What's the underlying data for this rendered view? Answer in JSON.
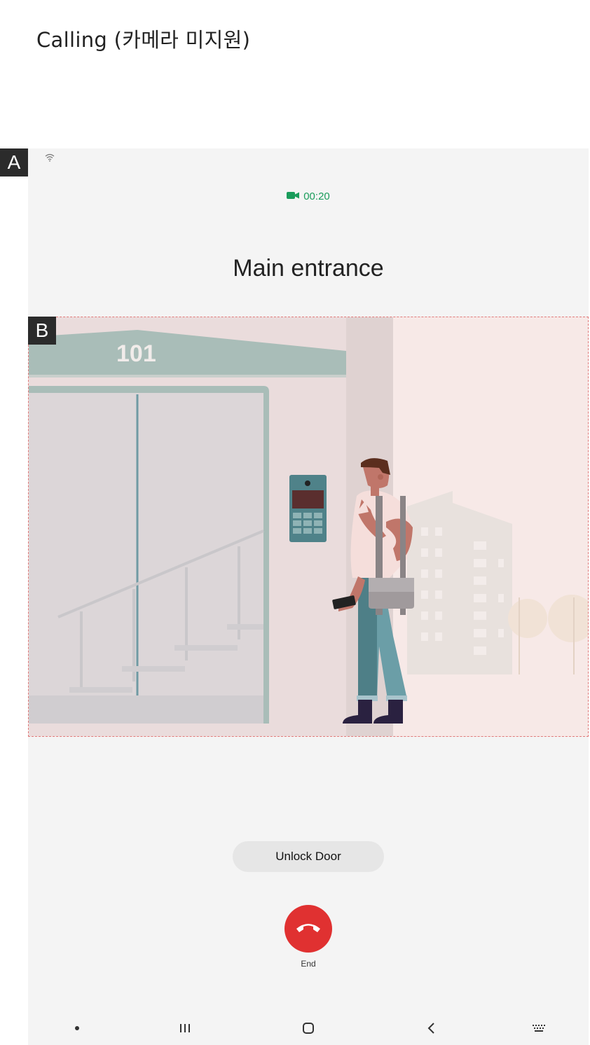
{
  "page": {
    "title": "Calling (카메라 미지원)"
  },
  "markers": {
    "a": "A",
    "b": "B"
  },
  "call": {
    "timer": "00:20",
    "callee": "Main entrance",
    "building_number": "101"
  },
  "actions": {
    "unlock_label": "Unlock Door",
    "end_label": "End"
  },
  "colors": {
    "timer_green": "#1a9c5b",
    "end_red": "#e03131",
    "video_bg": "#f7e9e7"
  },
  "navbar": {
    "icons": [
      "dot-icon",
      "recent-apps-icon",
      "home-icon",
      "back-icon",
      "keyboard-icon"
    ]
  }
}
